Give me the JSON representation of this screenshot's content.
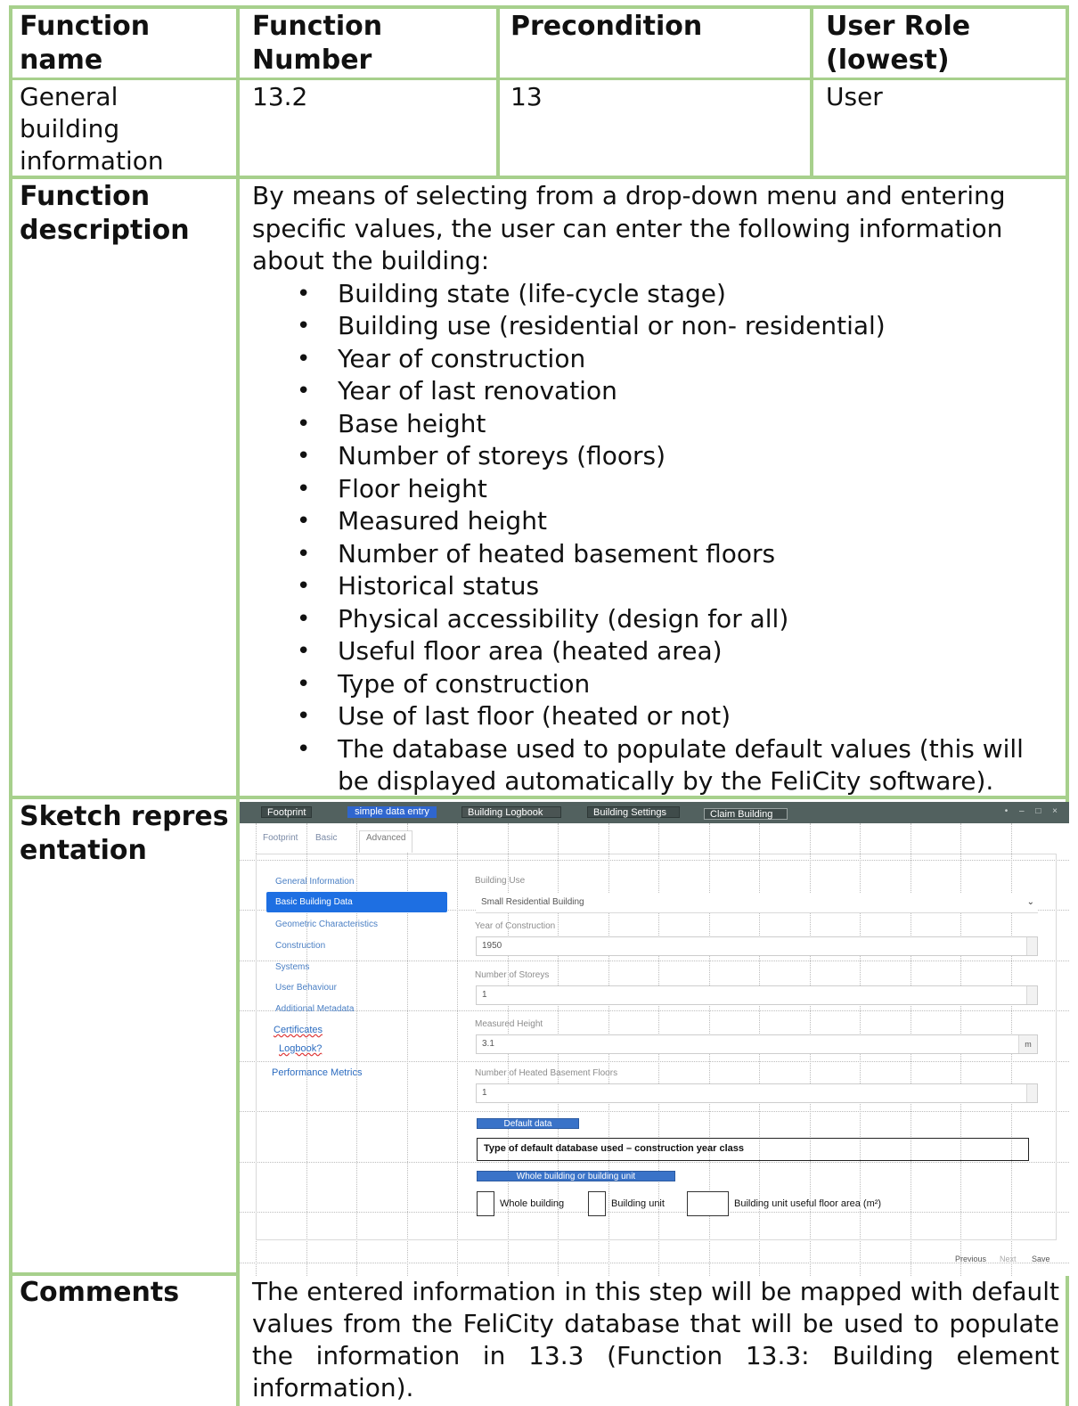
{
  "table": {
    "headers": {
      "function_name": "Function name",
      "function_number": "Function Number",
      "precondition": "Precondition",
      "user_role": "User Role (lowest)"
    },
    "row": {
      "function_name": "General building information",
      "function_number": "13.2",
      "precondition": "13",
      "user_role": "User"
    },
    "labels": {
      "function_description": "Function description",
      "sketch_representation": "Sketch representation",
      "comments": "Comments"
    },
    "description_intro": "By means of selecting from a drop-down menu and entering specific values, the user can enter the following information about the building:",
    "description_items": [
      "Building state (life-cycle stage)",
      "Building use (residential or non- residential)",
      "Year of construction",
      "Year of last renovation",
      "Base height",
      "Number of storeys (floors)",
      "Floor height",
      "Measured height",
      "Number of heated basement floors",
      "Historical status",
      "Physical accessibility (design for all)",
      "Useful floor area (heated area)",
      "Type of construction",
      "Use of last floor (heated or not)",
      "The database used to populate default values (this will be displayed automatically by the FeliCity software)."
    ],
    "comments_text": "The entered information in this step will be mapped with default values from the FeliCity database that will be used to populate the information in 13.3 (Function 13.3: Building element information)."
  },
  "sketch": {
    "topbar": {
      "footprint": "Footprint",
      "simple_data_entry": "simple data entry",
      "building_logbook": "Building Logbook",
      "building_settings": "Building Settings",
      "claim_building": "Claim Building",
      "window_controls": "• – □ ×"
    },
    "tabs": [
      "Footprint",
      "Basic",
      "Advanced"
    ],
    "nav": {
      "general_information": "General Information",
      "basic_building_data": "Basic Building Data",
      "geometric_characteristics": "Geometric Characteristics",
      "construction": "Construction",
      "systems": "Systems",
      "user_behaviour": "User Behaviour",
      "additional_metadata": "Additional Metadata",
      "certificates": "Certificates",
      "logbook": "Logbook?",
      "performance_metrics": "Performance Metrics"
    },
    "fields": {
      "building_use_label": "Building Use",
      "building_use_value": "Small Residential Building",
      "year_label": "Year of Construction",
      "year_value": "1950",
      "storeys_label": "Number of Storeys",
      "storeys_value": "1",
      "height_label": "Measured Height",
      "height_value": "3.1",
      "height_unit": "m",
      "basement_label": "Number of Heated Basement Floors",
      "basement_value": "1"
    },
    "default_data_tag": "Default data",
    "default_db_text": "Type of default database used – construction year class",
    "whole_building_tag": "Whole building or building unit",
    "checkboxes": {
      "whole_building": "Whole building",
      "building_unit": "Building unit",
      "useful_floor_area": "Building unit useful floor area (m²)"
    },
    "footer": {
      "previous": "Previous",
      "next": "Next",
      "save": "Save"
    }
  }
}
